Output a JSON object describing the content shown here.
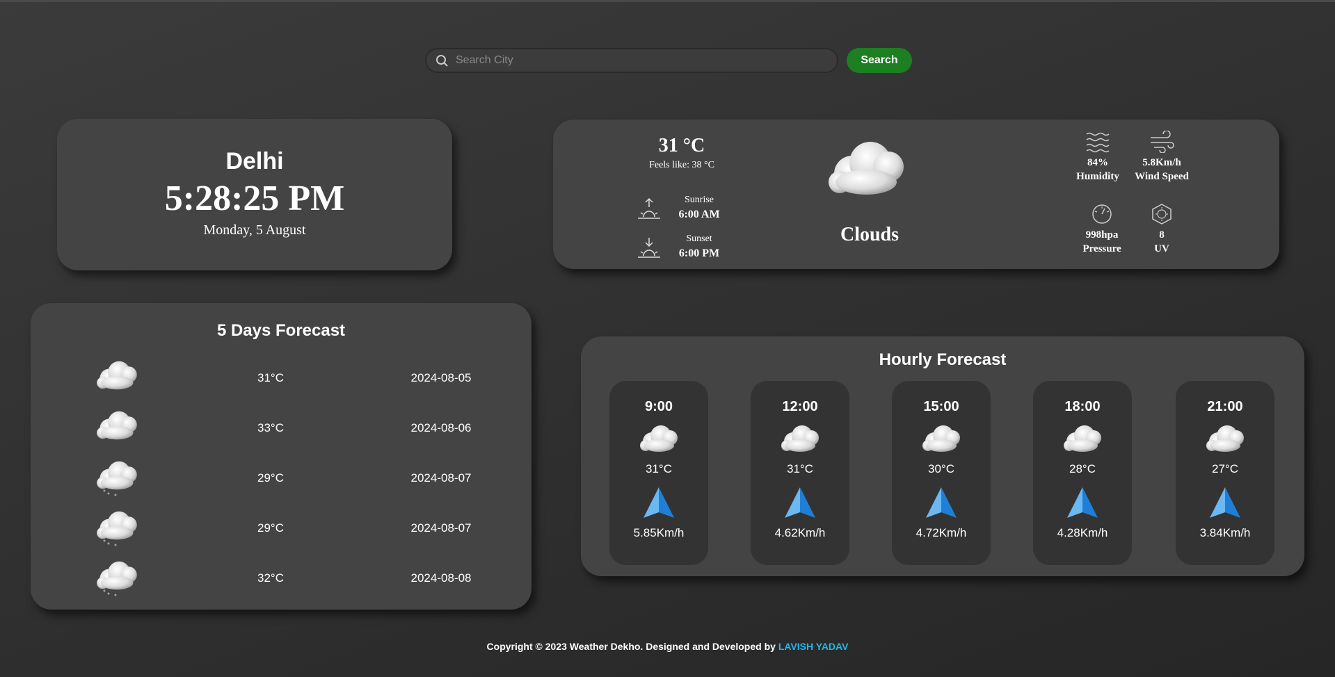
{
  "search": {
    "placeholder": "Search City",
    "button_label": "Search"
  },
  "clock": {
    "city": "Delhi",
    "time": "5:28:25 PM",
    "date": "Monday, 5 August"
  },
  "current": {
    "temperature": "31 °C",
    "feels_like": "Feels like: 38 °C",
    "sunrise_label": "Sunrise",
    "sunrise_time": "6:00 AM",
    "sunset_label": "Sunset",
    "sunset_time": "6:00 PM",
    "condition": "Clouds",
    "humidity_value": "84%",
    "humidity_label": "Humidity",
    "wind_value": "5.8Km/h",
    "wind_label": "Wind Speed",
    "pressure_value": "998hpa",
    "pressure_label": "Pressure",
    "uv_value": "8",
    "uv_label": "UV"
  },
  "five_day": {
    "title": "5 Days Forecast",
    "days": [
      {
        "icon": "clouds-icon",
        "temp": "31°C",
        "date": "2024-08-05"
      },
      {
        "icon": "clouds-icon",
        "temp": "33°C",
        "date": "2024-08-06"
      },
      {
        "icon": "rain-cloud-icon",
        "temp": "29°C",
        "date": "2024-08-07"
      },
      {
        "icon": "rain-cloud-icon",
        "temp": "29°C",
        "date": "2024-08-07"
      },
      {
        "icon": "rain-cloud-icon",
        "temp": "32°C",
        "date": "2024-08-08"
      }
    ]
  },
  "hourly": {
    "title": "Hourly Forecast",
    "hours": [
      {
        "time": "9:00",
        "temp": "31°C",
        "wind": "5.85Km/h"
      },
      {
        "time": "12:00",
        "temp": "31°C",
        "wind": "4.62Km/h"
      },
      {
        "time": "15:00",
        "temp": "30°C",
        "wind": "4.72Km/h"
      },
      {
        "time": "18:00",
        "temp": "28°C",
        "wind": "4.28Km/h"
      },
      {
        "time": "21:00",
        "temp": "27°C",
        "wind": "3.84Km/h"
      }
    ]
  },
  "footer": {
    "text": "Copyright © 2023 Weather Dekho. Designed and Developed by",
    "author": "LAVISH YADAV"
  },
  "colors": {
    "background": "#333333",
    "card": "#444444",
    "search_button": "#1e7e22",
    "author_link": "#22b7ea",
    "wind_arrow": "#3a9be8"
  }
}
